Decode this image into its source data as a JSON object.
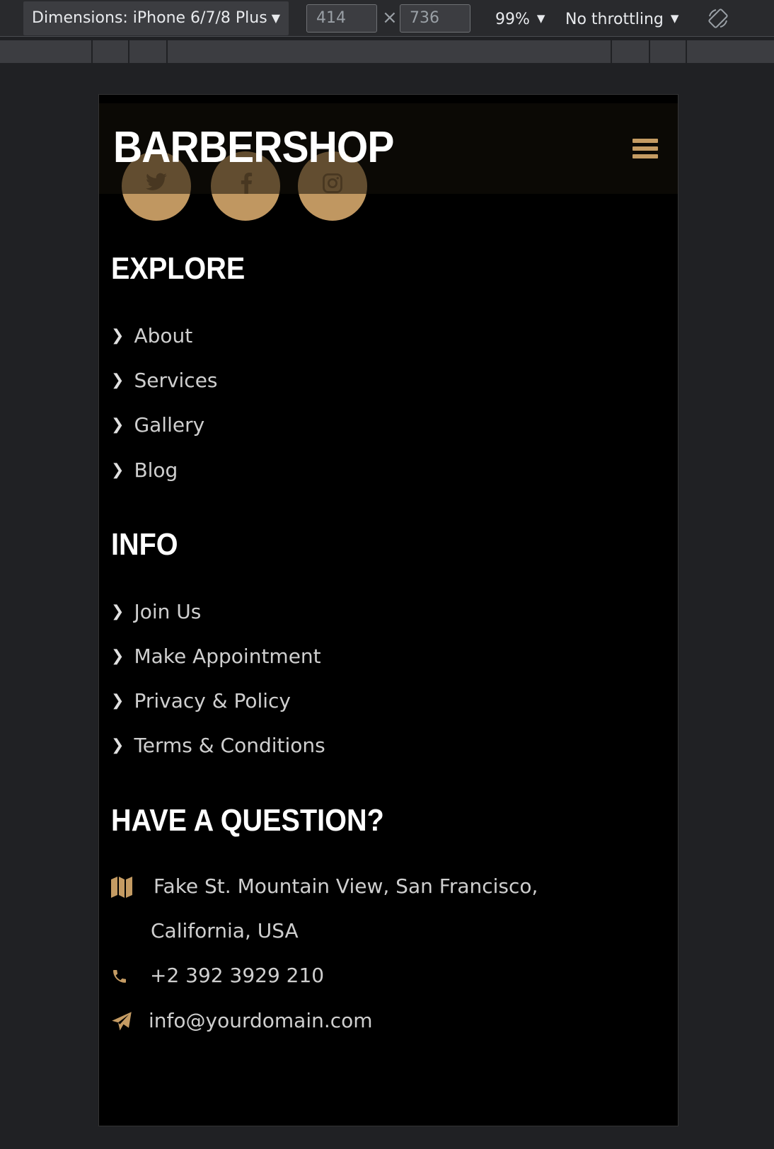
{
  "devtools": {
    "dimensions_label": "Dimensions: iPhone 6/7/8 Plus",
    "width_value": "414",
    "height_value": "736",
    "times_symbol": "×",
    "zoom": "99%",
    "throttling": "No throttling",
    "dropdown_arrow": "▼"
  },
  "site": {
    "brand": "BARBERSHOP",
    "accent_color": "#c49b63",
    "social_icons": [
      "twitter-icon",
      "facebook-icon",
      "instagram-icon"
    ]
  },
  "explore": {
    "title": "EXPLORE",
    "links": [
      "About",
      "Services",
      "Gallery",
      "Blog"
    ]
  },
  "info": {
    "title": "INFO",
    "links": [
      "Join Us",
      "Make Appointment",
      "Privacy & Policy",
      "Terms & Conditions"
    ]
  },
  "contact": {
    "title": "HAVE A QUESTION?",
    "address_line1": "Fake St. Mountain View, San Francisco,",
    "address_line2": "California, USA",
    "phone": "+2 392 3929 210",
    "email": "info@yourdomain.com"
  },
  "chevron": "❯"
}
